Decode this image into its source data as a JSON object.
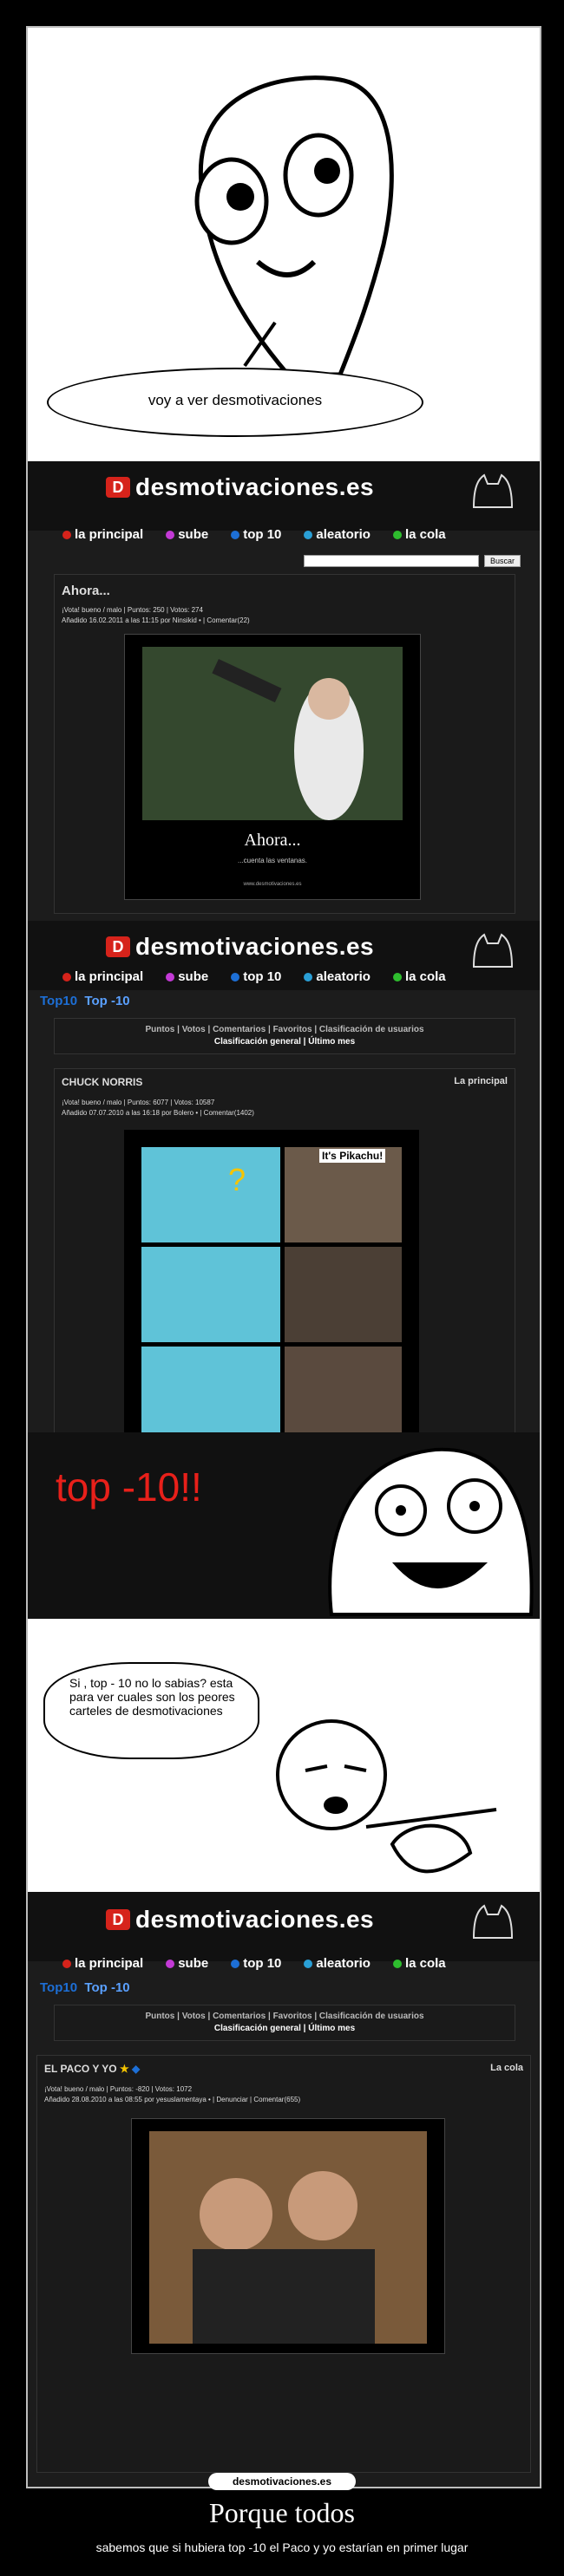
{
  "panel1": {
    "speech": "voy a ver desmotivaciones"
  },
  "site": {
    "logo_letter": "D",
    "logo_text": "desmotivaciones.es",
    "nav": [
      "la principal",
      "sube",
      "top 10",
      "aleatorio",
      "la cola"
    ],
    "search_button": "Buscar"
  },
  "post1": {
    "title": "Ahora...",
    "meta_line1": "¡Vota! bueno / malo | Puntos: 250 | Votos: 274",
    "meta_line2": "Añadido 16.02.2011 a las 11:15 por Ninsikid  •  | Comentar(22)",
    "poster_title": "Ahora...",
    "poster_sub": "...cuenta las ventanas.",
    "poster_url": "www.desmotivaciones.es"
  },
  "top10a": {
    "breadcrumb_home": "Top10",
    "breadcrumb": "Top -10",
    "tabs_line1": "Puntos | Votos | Comentarios | Favoritos | Clasificación de usuarios",
    "tabs_line2": "Clasificación general | Último mes",
    "post_title": "CHUCK NORRIS",
    "post_section": "La principal",
    "meta_line1": "¡Vota! bueno / malo | Puntos: 6077 | Votos: 10587",
    "meta_line2": "Añadido 07.07.2010 a las 16:18 por Bolero  •  | Comentar(1402)",
    "img_label": "It's Pikachu!"
  },
  "top10_reaction": {
    "text": "top -10!!"
  },
  "panel_speech": {
    "text": "Si , top - 10 no lo sabias? esta para ver cuales son los peores carteles de desmotivaciones"
  },
  "top10b": {
    "breadcrumb_home": "Top10",
    "breadcrumb": "Top -10",
    "tabs_line1": "Puntos | Votos | Comentarios | Favoritos | Clasificación de usuarios",
    "tabs_line2": "Clasificación general | Último mes",
    "post_title": "EL PACO Y YO",
    "post_section": "La cola",
    "meta_line1": "¡Vota! bueno / malo | Puntos: -820 | Votos: 1072",
    "meta_line2": "Añadido 28.08.2010 a las 08:55 por yesuslamentaya  •  | Denunciar | Comentar(655)"
  },
  "footer": {
    "badge": "desmotivaciones.es",
    "title": "Porque todos",
    "subtitle": "sabemos que si hubiera top -10 el Paco y yo estarían en primer lugar"
  },
  "colors": {
    "brand_red": "#d6231b",
    "green": "#2ebd2e",
    "blue": "#1d6fd6"
  }
}
